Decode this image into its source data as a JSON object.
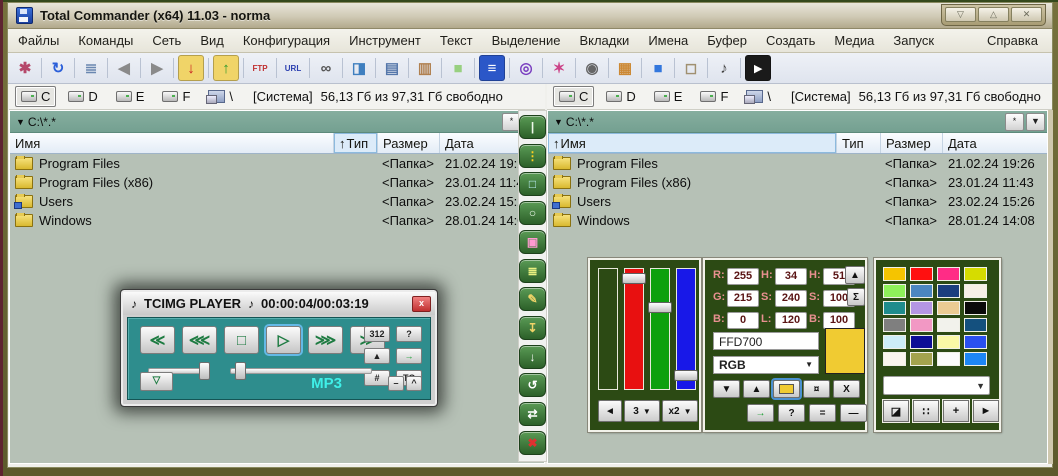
{
  "window": {
    "title": "Total Commander (x64) 11.03 - norma",
    "minimize_glyph": "▽",
    "restore_glyph": "△",
    "close_glyph": "✕"
  },
  "menu": {
    "items": [
      "Файлы",
      "Команды",
      "Сеть",
      "Вид",
      "Конфигурация",
      "Инструмент",
      "Текст",
      "Выделение",
      "Вкладки",
      "Имена",
      "Буфер",
      "Создать",
      "Медиа",
      "Запуск"
    ],
    "help": "Справка"
  },
  "toolbar": {
    "icons": [
      {
        "name": "options-star-icon",
        "glyph": "✱",
        "color": "#b5486a",
        "bg": ""
      },
      {
        "name": "refresh-icon",
        "glyph": "↻",
        "color": "#2b5fd9",
        "bg": ""
      },
      {
        "name": "brief-view-icon",
        "glyph": "≣",
        "color": "#6a87b0",
        "bg": ""
      },
      {
        "name": "back-icon",
        "glyph": "◀",
        "color": "#8a8a8a",
        "bg": ""
      },
      {
        "name": "forward-icon",
        "glyph": "▶",
        "color": "#8a8a8a",
        "bg": ""
      },
      {
        "name": "unpack-icon",
        "glyph": "↓",
        "color": "#c82020",
        "bg": "#f0d468"
      },
      {
        "name": "pack-icon",
        "glyph": "↑",
        "color": "#2e9a2e",
        "bg": "#f0d468"
      },
      {
        "name": "ftp-icon",
        "glyph": "FTP",
        "color": "#c03030",
        "bg": ""
      },
      {
        "name": "url-icon",
        "glyph": "URL",
        "color": "#2b3fb0",
        "bg": ""
      },
      {
        "name": "search-binoculars-icon",
        "glyph": "∞",
        "color": "#555555",
        "bg": ""
      },
      {
        "name": "quick-view-icon",
        "glyph": "◨",
        "color": "#3f7fbf",
        "bg": ""
      },
      {
        "name": "compare-lists-icon",
        "glyph": "▤",
        "color": "#5577aa",
        "bg": ""
      },
      {
        "name": "clipboard-paste-icon",
        "glyph": "▥",
        "color": "#b08050",
        "bg": ""
      },
      {
        "name": "notes-icon",
        "glyph": "■",
        "color": "#98d080",
        "bg": ""
      },
      {
        "name": "save-floppy-icon",
        "glyph": "≡",
        "color": "#ffffff",
        "bg": "#2b57c8"
      },
      {
        "name": "discs-icon",
        "glyph": "◎",
        "color": "#7a3fc0",
        "bg": ""
      },
      {
        "name": "palette-icon",
        "glyph": "✶",
        "color": "#cc4488",
        "bg": ""
      },
      {
        "name": "camera-icon",
        "glyph": "◉",
        "color": "#666666",
        "bg": ""
      },
      {
        "name": "archive-box-icon",
        "glyph": "▦",
        "color": "#cc8833",
        "bg": ""
      },
      {
        "name": "desktop-icon",
        "glyph": "■",
        "color": "#3377dd",
        "bg": ""
      },
      {
        "name": "tv-icon",
        "glyph": "◻",
        "color": "#a09070",
        "bg": ""
      },
      {
        "name": "sound-icon",
        "glyph": "♪",
        "color": "#444444",
        "bg": ""
      },
      {
        "name": "cmd-icon",
        "glyph": "▸",
        "color": "#ffffff",
        "bg": "#1a1a1a"
      }
    ]
  },
  "drivebar": {
    "drives": [
      "C",
      "D",
      "E",
      "F"
    ],
    "selected": "C",
    "network_label": "\\",
    "volume_label": "[Система]",
    "free_info": "56,13 Гб из 97,31 Гб свободно"
  },
  "file_panels": {
    "columns": {
      "name": "Имя",
      "type": "Тип",
      "size": "Размер",
      "date": "Дата"
    },
    "sort_glyph": "↑",
    "left": {
      "path": "C:\\*.*",
      "star_button": "*",
      "dropdown_glyph": "▼",
      "sorted_column": "type"
    },
    "right": {
      "path": "C:\\*.*",
      "star_button": "*",
      "dropdown_glyph": "▼",
      "sorted_column": "name"
    },
    "rows": [
      {
        "name": "Program Files",
        "icon": "folder",
        "size": "<Папка>",
        "date": "21.02.24 19:26"
      },
      {
        "name": "Program Files (x86)",
        "icon": "folder",
        "size": "<Папка>",
        "date": "23.01.24 11:43"
      },
      {
        "name": "Users",
        "icon": "folder-shared",
        "size": "<Папка>",
        "date": "23.02.24 15:26"
      },
      {
        "name": "Windows",
        "icon": "folder",
        "size": "<Папка>",
        "date": "28.01.24 14:08"
      }
    ]
  },
  "middle_toolbar": {
    "buttons": [
      {
        "name": "start-button",
        "glyph": "|",
        "color": "#eef8ea"
      },
      {
        "name": "traffic-light-button",
        "glyph": "⋮",
        "color": "#ffd020"
      },
      {
        "name": "monitor-button",
        "glyph": "□",
        "color": "#bfeffa"
      },
      {
        "name": "search-button",
        "glyph": "○",
        "color": "#eef8ea"
      },
      {
        "name": "copy-stack-button",
        "glyph": "▣",
        "color": "#ff9ad0"
      },
      {
        "name": "list-save-button",
        "glyph": "≣",
        "color": "#e8f080"
      },
      {
        "name": "archive-edit-button",
        "glyph": "✎",
        "color": "#f0d468"
      },
      {
        "name": "unpack-edit-button",
        "glyph": "↧",
        "color": "#f0d468"
      },
      {
        "name": "download-button",
        "glyph": "↓",
        "color": "#ffffff"
      },
      {
        "name": "repeat-button",
        "glyph": "↺",
        "color": "#ffffff"
      },
      {
        "name": "swap-button",
        "glyph": "⇄",
        "color": "#ffffff"
      },
      {
        "name": "close-red-button",
        "glyph": "✖",
        "color": "#e03030"
      }
    ]
  },
  "player": {
    "note_glyph": "♪",
    "title": "TCIMG PLAYER",
    "time": "00:00:04/00:03:19",
    "close_glyph": "x",
    "transport": [
      {
        "name": "prev-track-button",
        "glyph": "≪",
        "active": false
      },
      {
        "name": "rewind-button",
        "glyph": "⋘",
        "active": false
      },
      {
        "name": "stop-button",
        "glyph": "□",
        "active": false
      },
      {
        "name": "play-button",
        "glyph": "▷",
        "active": true
      },
      {
        "name": "fast-forward-button",
        "glyph": "⋙",
        "active": false
      },
      {
        "name": "next-track-button",
        "glyph": "≫",
        "active": false
      }
    ],
    "aux": [
      {
        "name": "preset-312-button",
        "glyph": "312",
        "color": "#222222"
      },
      {
        "name": "help-button",
        "glyph": "?",
        "color": "#222222"
      },
      {
        "name": "eject-button",
        "glyph": "▲",
        "color": "#222222"
      },
      {
        "name": "pin-button",
        "glyph": "→",
        "color": "#18a030"
      },
      {
        "name": "number-button",
        "glyph": "#",
        "color": "#222222"
      },
      {
        "name": "tc-button",
        "glyph": "TC",
        "color": "#222222"
      }
    ],
    "format": "MP3",
    "collapse_glyph": "▽",
    "minimize_glyph": "–",
    "up_glyph": "^"
  },
  "color_tool": {
    "slider_panel": {
      "tracks": [
        {
          "name": "empty-track",
          "color": "#2c4a14",
          "thumb": null
        },
        {
          "name": "red-track",
          "color": "#e81010",
          "thumb": 0.04
        },
        {
          "name": "green-track",
          "color": "#0da00d",
          "thumb": 0.3
        },
        {
          "name": "blue-track",
          "color": "#1818e8",
          "thumb": 0.93
        }
      ],
      "back_glyph": "◄",
      "count_value": "3",
      "zoom_value": "x2",
      "dd_glyph": "▼"
    },
    "value_panel": {
      "fields": [
        {
          "label": "R:",
          "value": "255"
        },
        {
          "label": "H:",
          "value": "34"
        },
        {
          "label": "H:",
          "value": "51"
        },
        {
          "label": "G:",
          "value": "215"
        },
        {
          "label": "S:",
          "value": "240"
        },
        {
          "label": "S:",
          "value": "100"
        },
        {
          "label": "B:",
          "value": "0"
        },
        {
          "label": "L:",
          "value": "120"
        },
        {
          "label": "B:",
          "value": "100"
        }
      ],
      "up_glyph": "▲",
      "sum_glyph": "Σ",
      "hex": "FFD700",
      "mode": "RGB",
      "mode_dd_glyph": "▼",
      "swatch_color": "#f0cb32",
      "buttons_row1": [
        {
          "name": "down-button",
          "glyph": "▼"
        },
        {
          "name": "up-button",
          "glyph": "▲"
        },
        {
          "name": "color-chip-button",
          "glyph": "swatch"
        },
        {
          "name": "currency-button",
          "glyph": "¤"
        },
        {
          "name": "x-button",
          "glyph": "X"
        }
      ],
      "buttons_row2": [
        {
          "name": "apply-arrow-button",
          "glyph": "→",
          "color": "#18a030"
        },
        {
          "name": "help-button",
          "glyph": "?"
        },
        {
          "name": "equals-button",
          "glyph": "="
        },
        {
          "name": "dash-button",
          "glyph": "—"
        }
      ]
    },
    "palette_panel": {
      "colors": [
        "#f5c400",
        "#ff1010",
        "#ff2c86",
        "#d6dc00",
        "#8ef05a",
        "#4b86c0",
        "#1b3d7e",
        "#f7efe7",
        "#1f8c8c",
        "#b496e4",
        "#ebcb93",
        "#0a0a0a",
        "#7f7f7f",
        "#f298c4",
        "#f2f2ec",
        "#14507e",
        "#cdedf8",
        "#0d0d96",
        "#faf8a6",
        "#2a50f0",
        "#faf6ee",
        "#a3a34e",
        "#fbfbfb",
        "#1d86f5"
      ],
      "dropdown_value": "",
      "dd_glyph": "▼",
      "buttons": [
        {
          "name": "contrast-button",
          "glyph": "◪"
        },
        {
          "name": "dots-grid-button",
          "glyph": "∷"
        },
        {
          "name": "add-button",
          "glyph": "+"
        },
        {
          "name": "play-right-button",
          "glyph": "►"
        }
      ]
    }
  }
}
